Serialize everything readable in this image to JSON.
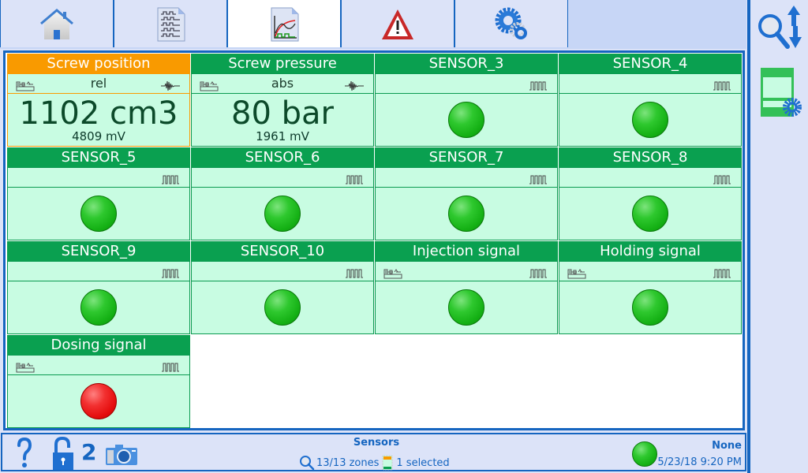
{
  "tabs": [
    {
      "name": "home",
      "icon": "home-icon",
      "active": false
    },
    {
      "name": "data-log",
      "icon": "document-waves-icon",
      "active": false
    },
    {
      "name": "chart",
      "icon": "chart-document-icon",
      "active": true
    },
    {
      "name": "alarms",
      "icon": "warning-icon",
      "active": false
    },
    {
      "name": "settings",
      "icon": "gears-icon",
      "active": false
    }
  ],
  "sidebar": {
    "buttons": [
      {
        "icon": "zoom-sort-icon"
      },
      {
        "icon": "zone-settings-icon"
      }
    ]
  },
  "zones": [
    {
      "title": "Screw position",
      "mode": "rel",
      "type": "analog",
      "value": "1102 cm3",
      "raw": "4809 mV",
      "selected": true,
      "has_input_icon": true
    },
    {
      "title": "Screw pressure",
      "mode": "abs",
      "type": "analog",
      "value": "80 bar",
      "raw": "1961 mV",
      "selected": false,
      "has_input_icon": true
    },
    {
      "title": "SENSOR_3",
      "mode": "",
      "type": "digital",
      "state": "green",
      "selected": false,
      "has_input_icon": false
    },
    {
      "title": "SENSOR_4",
      "mode": "",
      "type": "digital",
      "state": "green",
      "selected": false,
      "has_input_icon": false
    },
    {
      "title": "SENSOR_5",
      "mode": "",
      "type": "digital",
      "state": "green",
      "selected": false,
      "has_input_icon": false
    },
    {
      "title": "SENSOR_6",
      "mode": "",
      "type": "digital",
      "state": "green",
      "selected": false,
      "has_input_icon": false
    },
    {
      "title": "SENSOR_7",
      "mode": "",
      "type": "digital",
      "state": "green",
      "selected": false,
      "has_input_icon": false
    },
    {
      "title": "SENSOR_8",
      "mode": "",
      "type": "digital",
      "state": "green",
      "selected": false,
      "has_input_icon": false
    },
    {
      "title": "SENSOR_9",
      "mode": "",
      "type": "digital",
      "state": "green",
      "selected": false,
      "has_input_icon": false
    },
    {
      "title": "SENSOR_10",
      "mode": "",
      "type": "digital",
      "state": "green",
      "selected": false,
      "has_input_icon": false
    },
    {
      "title": "Injection signal",
      "mode": "",
      "type": "digital",
      "state": "green",
      "selected": false,
      "has_input_icon": true
    },
    {
      "title": "Holding signal",
      "mode": "",
      "type": "digital",
      "state": "green",
      "selected": false,
      "has_input_icon": true
    },
    {
      "title": "Dosing signal",
      "mode": "",
      "type": "digital",
      "state": "red",
      "selected": false,
      "has_input_icon": true
    }
  ],
  "colors": {
    "header_green": "#0aa050",
    "header_selected": "#f99a00",
    "cell_bg": "#c8fce2",
    "accent_blue": "#1565c0",
    "led_green": "#14b014",
    "led_red": "#e40c0c"
  },
  "statusbar": {
    "help_icon": "question-icon",
    "lock_icon": "unlocked-padlock-icon",
    "user_level": "2",
    "camera_icon": "camera-icon",
    "title": "Sensors",
    "zones_count": "13/13 zones",
    "selected_count": "1 selected",
    "status_led": "green",
    "alarm_text": "None",
    "datetime": "5/23/18 9:20 PM"
  }
}
